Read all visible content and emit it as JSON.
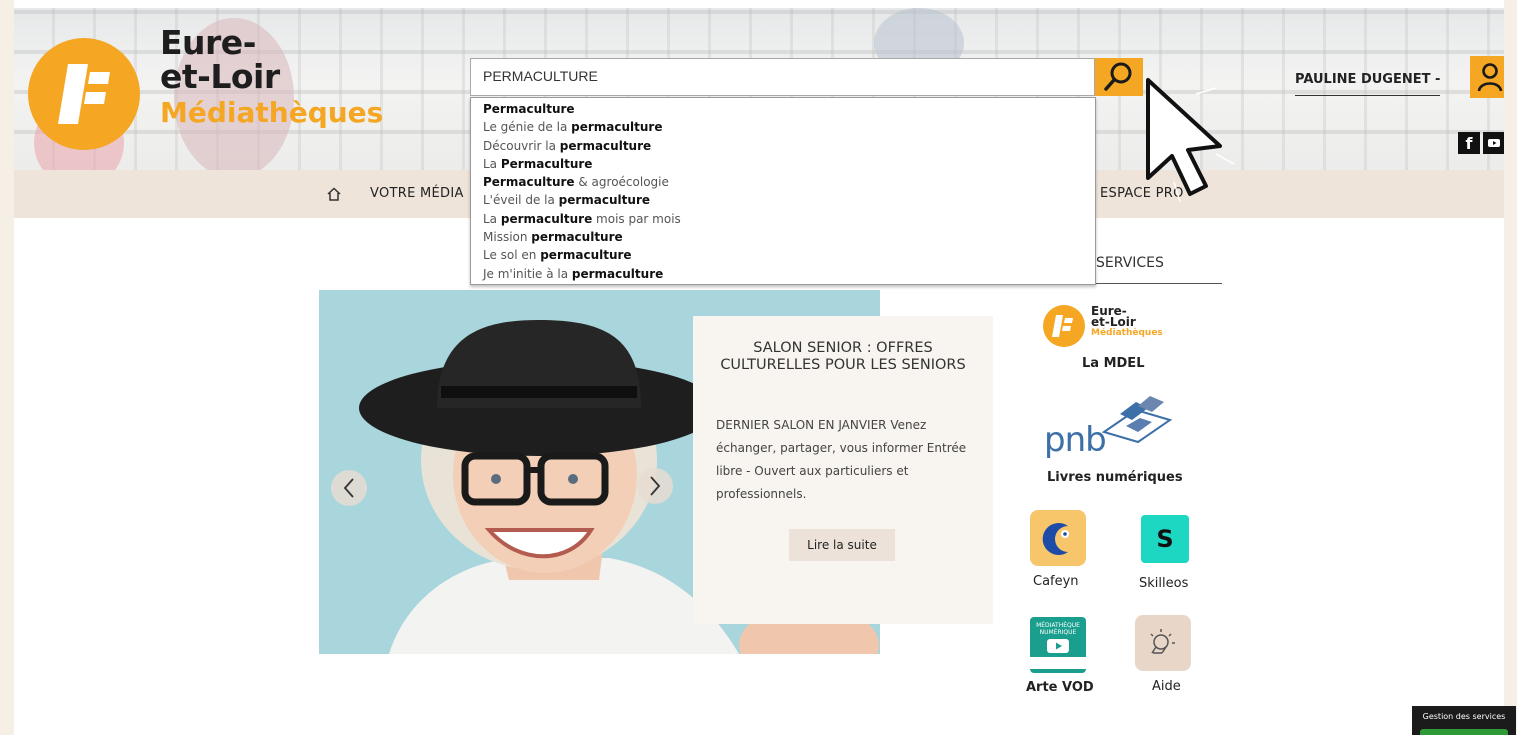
{
  "header": {
    "logo": {
      "line1": "Eure-",
      "line2": "et-Loir",
      "line3": "Médiathèques"
    },
    "search": {
      "value": "PERMACULTURE",
      "button_icon": "search-icon"
    },
    "user": {
      "name": "PAULINE DUGENET -",
      "icon": "user-icon"
    },
    "social": {
      "facebook": "f",
      "youtube_icon": "youtube-icon"
    }
  },
  "nav": {
    "home_icon": "home-icon",
    "items": [
      {
        "label": "VOTRE MÉDIA"
      },
      {
        "label": "ESPACE PRO"
      }
    ]
  },
  "autocomplete": {
    "items": [
      {
        "pre": "",
        "bold": "Permaculture",
        "post": ""
      },
      {
        "pre": "Le génie de la ",
        "bold": "permaculture",
        "post": ""
      },
      {
        "pre": "Découvrir la ",
        "bold": "permaculture",
        "post": ""
      },
      {
        "pre": "La ",
        "bold": "Permaculture",
        "post": ""
      },
      {
        "pre": "",
        "bold": "Permaculture",
        "post": " & agroécologie"
      },
      {
        "pre": "L'éveil de la ",
        "bold": "permaculture",
        "post": ""
      },
      {
        "pre": "La ",
        "bold": "permaculture",
        "post": " mois par mois"
      },
      {
        "pre": "Mission ",
        "bold": "permaculture",
        "post": ""
      },
      {
        "pre": "Le sol en ",
        "bold": "permaculture",
        "post": ""
      },
      {
        "pre": "Je m'initie à la ",
        "bold": "permaculture",
        "post": ""
      }
    ]
  },
  "carousel": {
    "title": "SALON SENIOR : OFFRES CULTURELLES POUR LES SENIORS",
    "body": "DERNIER SALON EN JANVIER Venez échanger, partager, vous informer Entrée libre - Ouvert aux particuliers et professionnels.",
    "button": "Lire la suite",
    "prev_icon": "chevron-left-icon",
    "next_icon": "chevron-right-icon"
  },
  "services": {
    "title": "SERVICES",
    "mdel": {
      "logo_line1": "Eure-",
      "logo_line2": "et-Loir",
      "logo_line3": "Médiathèques",
      "label": "La MDEL"
    },
    "pnb": {
      "logo_text": "pnb",
      "label": "Livres numériques"
    },
    "cafeyn": {
      "label": "Cafeyn"
    },
    "skilleos": {
      "letter": "S",
      "label": "Skilleos"
    },
    "artevod": {
      "tile_line1": "MÉDIATHÈQUE",
      "tile_line2": "NUMÉRIQUE",
      "label": "Arte VOD"
    },
    "aide": {
      "label": "Aide"
    }
  },
  "footer": {
    "gestion": "Gestion des services"
  },
  "colors": {
    "accent": "#f5a623",
    "nav_bg": "#efe4da",
    "slide_bg": "#a9d6dc",
    "outer_bg": "#f6efe6"
  }
}
